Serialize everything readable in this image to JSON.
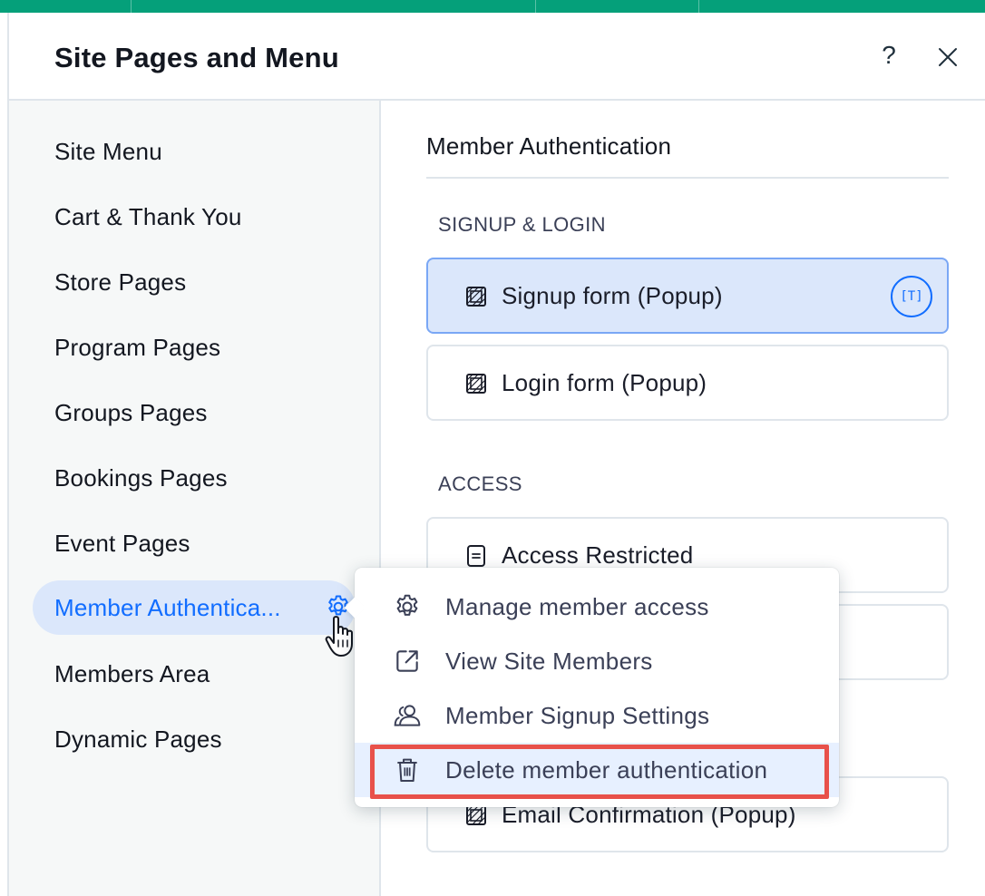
{
  "panel": {
    "title": "Site Pages and Menu",
    "help_label": "?",
    "close_icon": "close-icon"
  },
  "sidebar": {
    "items": [
      {
        "label": "Site Menu"
      },
      {
        "label": "Cart & Thank You"
      },
      {
        "label": "Store Pages"
      },
      {
        "label": "Program Pages"
      },
      {
        "label": "Groups Pages"
      },
      {
        "label": "Bookings Pages"
      },
      {
        "label": "Event Pages"
      },
      {
        "label": "Member Authentica...",
        "active": true,
        "icon": "gear-icon"
      },
      {
        "label": "Members Area"
      },
      {
        "label": "Dynamic Pages"
      }
    ]
  },
  "content": {
    "section_title": "Member Authentication",
    "groups": [
      {
        "label": "SIGNUP & LOGIN",
        "pages": [
          {
            "label": "Signup form (Popup)",
            "icon": "popup-page-icon",
            "selected": true,
            "badge": "[T]"
          },
          {
            "label": "Login form (Popup)",
            "icon": "popup-page-icon"
          }
        ]
      },
      {
        "label": "ACCESS",
        "pages": [
          {
            "label": "Access Restricted",
            "icon": "page-icon"
          },
          {
            "label": "",
            "icon": ""
          },
          {
            "label": "Email Confirmation (Popup)",
            "icon": "popup-page-icon"
          }
        ]
      }
    ]
  },
  "context_menu": {
    "items": [
      {
        "label": "Manage member access",
        "icon": "gear-icon"
      },
      {
        "label": "View Site Members",
        "icon": "external-link-icon"
      },
      {
        "label": "Member Signup Settings",
        "icon": "members-icon"
      },
      {
        "label": "Delete member authentication",
        "icon": "trash-icon",
        "highlighted": true
      }
    ]
  },
  "colors": {
    "accent": "#116dff",
    "active_bg": "#dbe7fb",
    "top_bar": "#05a07a",
    "highlight_border": "#e8514a"
  }
}
